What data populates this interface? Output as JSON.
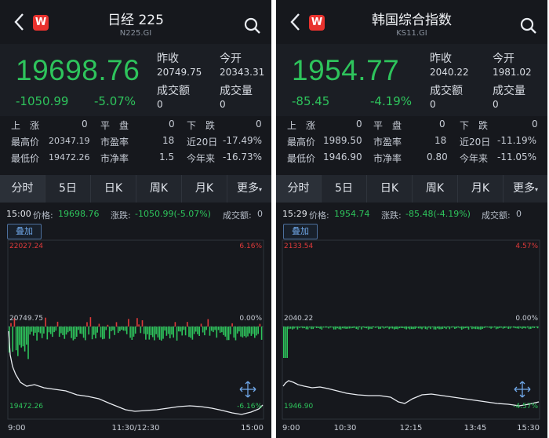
{
  "panels": [
    {
      "title": "日经 225",
      "code": "N225.GI",
      "price": "19698.76",
      "change": "-1050.99",
      "change_pct": "-5.07%",
      "prev_close_label": "昨收",
      "prev_close": "20749.75",
      "open_label": "今开",
      "open": "20343.31",
      "turnover_label": "成交额",
      "turnover": "0",
      "volume_label": "成交量",
      "volume": "0",
      "stats": {
        "up_label": "上　涨",
        "up": "0",
        "flat_label": "平　盘",
        "flat": "0",
        "down_label": "下　跌",
        "down": "0",
        "high_label": "最高价",
        "high": "20347.19",
        "pe_label": "市盈率",
        "pe": "18",
        "d20_label": "近20日",
        "d20": "-17.49%",
        "low_label": "最低价",
        "low": "19472.26",
        "pb_label": "市净率",
        "pb": "1.5",
        "ytd_label": "今年来",
        "ytd": "-16.73%"
      },
      "tabs": [
        "分时",
        "5日",
        "日K",
        "周K",
        "月K",
        "更多"
      ],
      "info": {
        "time": "15:00",
        "price_label": "价格:",
        "price": "19698.76",
        "chg_label": "涨跌:",
        "chg": "-1050.99(-5.07%)",
        "amt_label": "成交额:",
        "amt": "0"
      },
      "chart": {
        "overlay_label": "叠加",
        "y_top": "22027.24",
        "y_top_pct": "6.16%",
        "y_mid": "20749.75",
        "y_mid_pct": "0.00%",
        "y_bot": "19472.26",
        "y_bot_pct": "-6.16%",
        "x_labels": [
          "9:00",
          "11:30/12:30",
          "15:00"
        ]
      }
    },
    {
      "title": "韩国综合指数",
      "code": "KS11.GI",
      "price": "1954.77",
      "change": "-85.45",
      "change_pct": "-4.19%",
      "prev_close_label": "昨收",
      "prev_close": "2040.22",
      "open_label": "今开",
      "open": "1981.02",
      "turnover_label": "成交额",
      "turnover": "0",
      "volume_label": "成交量",
      "volume": "0",
      "stats": {
        "up_label": "上　涨",
        "up": "0",
        "flat_label": "平　盘",
        "flat": "0",
        "down_label": "下　跌",
        "down": "0",
        "high_label": "最高价",
        "high": "1989.50",
        "pe_label": "市盈率",
        "pe": "18",
        "d20_label": "近20日",
        "d20": "-11.19%",
        "low_label": "最低价",
        "low": "1946.90",
        "pb_label": "市净率",
        "pb": "0.80",
        "ytd_label": "今年来",
        "ytd": "-11.05%"
      },
      "tabs": [
        "分时",
        "5日",
        "日K",
        "周K",
        "月K",
        "更多"
      ],
      "info": {
        "time": "15:29",
        "price_label": "价格:",
        "price": "1954.74",
        "chg_label": "涨跌:",
        "chg": "-85.48(-4.19%)",
        "amt_label": "成交额:",
        "amt": "0"
      },
      "chart": {
        "overlay_label": "叠加",
        "y_top": "2133.54",
        "y_top_pct": "4.57%",
        "y_mid": "2040.22",
        "y_mid_pct": "0.00%",
        "y_bot": "1946.90",
        "y_bot_pct": "-4.57%",
        "x_labels": [
          "9:00",
          "10:30",
          "12:15",
          "13:45",
          "15:30"
        ]
      }
    }
  ],
  "colors": {
    "up": "#e03a3a",
    "down": "#2ec45c",
    "price_line": "#e9ecf1",
    "accent_blue": "#6fa7e8",
    "logo_red": "#e8322e"
  }
}
